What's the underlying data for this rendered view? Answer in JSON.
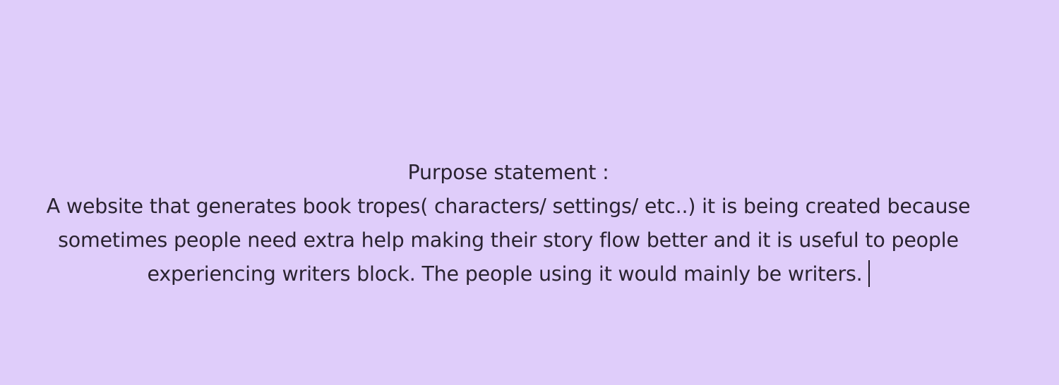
{
  "text_box": {
    "heading": "Purpose statement :",
    "lines": [
      "A website that generates book tropes( characters/ settings/ etc..) it is being created because",
      "sometimes people need extra help making their story flow better and it is useful to people",
      "experiencing writers block. The people using it would mainly be writers."
    ]
  },
  "colors": {
    "background": "#dfcdfa",
    "text": "#2a2331"
  }
}
